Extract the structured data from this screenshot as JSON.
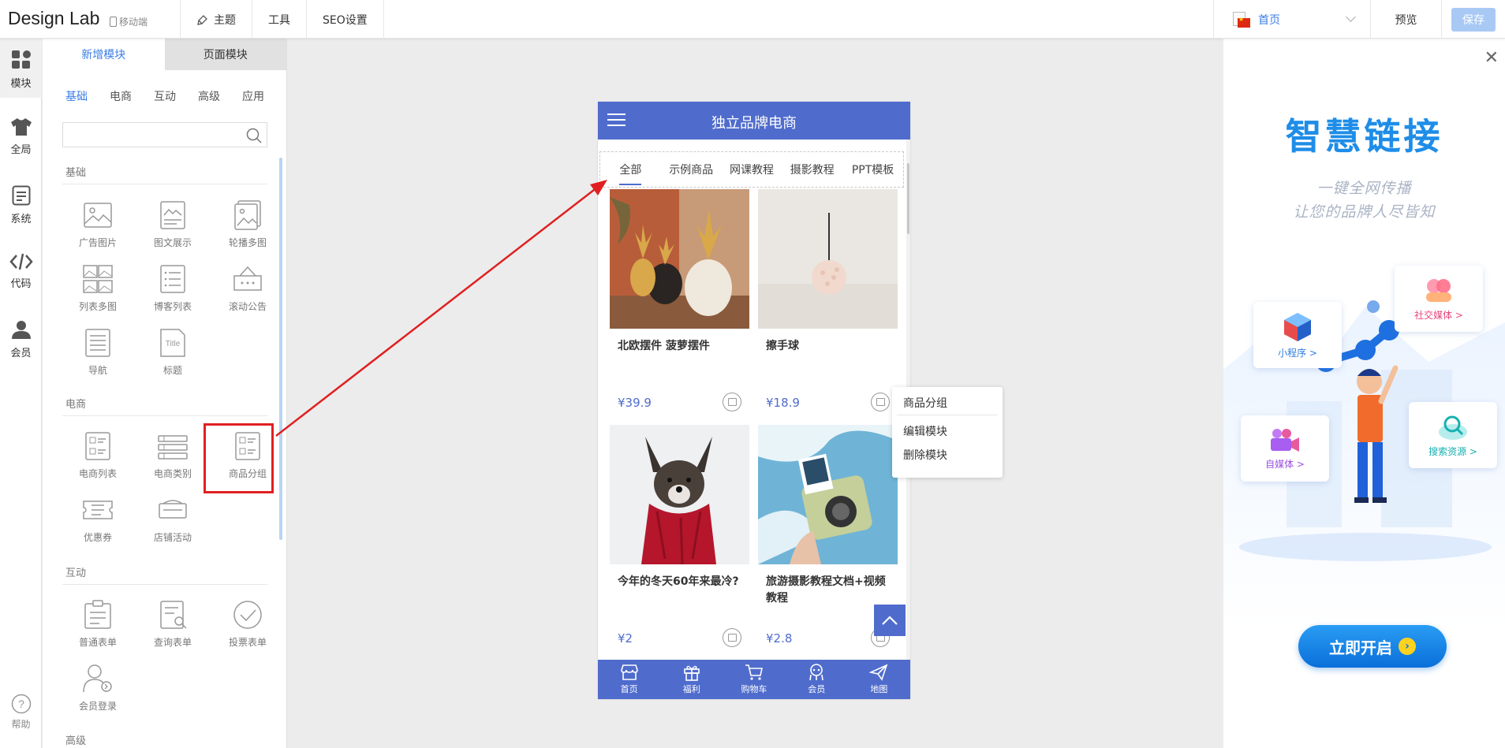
{
  "topbar": {
    "brand": "Design Lab",
    "mobile_label": "移动端",
    "menu": [
      "主题",
      "工具",
      "SEO设置"
    ],
    "page_select": "首页",
    "preview": "预览",
    "save": "保存"
  },
  "rail": {
    "items": [
      "模块",
      "全局",
      "系统",
      "代码",
      "会员"
    ],
    "help": "帮助"
  },
  "panel": {
    "tabs": [
      "新增模块",
      "页面模块"
    ],
    "categories": [
      "基础",
      "电商",
      "互动",
      "高级",
      "应用"
    ],
    "search_placeholder": "",
    "sections": {
      "basic": {
        "title": "基础",
        "modules": [
          "广告图片",
          "图文展示",
          "轮播多图",
          "列表多图",
          "博客列表",
          "滚动公告",
          "导航",
          "标题"
        ]
      },
      "ecommerce": {
        "title": "电商",
        "modules": [
          "电商列表",
          "电商类别",
          "商品分组",
          "优惠券",
          "店铺活动"
        ]
      },
      "interact": {
        "title": "互动",
        "modules": [
          "普通表单",
          "查询表单",
          "投票表单",
          "会员登录"
        ]
      },
      "advanced": {
        "title": "高级"
      }
    }
  },
  "phone": {
    "title": "独立品牌电商",
    "tabs": [
      "全部",
      "示例商品",
      "网课教程",
      "摄影教程",
      "PPT模板"
    ],
    "products": [
      {
        "name": "北欧摆件 菠萝摆件",
        "price": "¥39.9"
      },
      {
        "name": "擦手球",
        "price": "¥18.9"
      },
      {
        "name": "今年的冬天60年来最冷?",
        "price": "¥2"
      },
      {
        "name": "旅游摄影教程文档+视频教程",
        "price": "¥2.8"
      }
    ],
    "tabbar": [
      "首页",
      "福利",
      "购物车",
      "会员",
      "地图"
    ]
  },
  "context_menu": {
    "title": "商品分组",
    "items": [
      "编辑模块",
      "删除模块"
    ]
  },
  "ad": {
    "title": "智慧链接",
    "subtitle_1": "一键全网传播",
    "subtitle_2": "让您的品牌人尽皆知",
    "cards": [
      "小程序 >",
      "社交媒体 >",
      "自媒体 >",
      "搜索资源 >"
    ],
    "cta": "立即开启"
  },
  "colors": {
    "accent": "#3b7de9",
    "phone_theme": "#4f6ccd",
    "highlight": "#e02020"
  }
}
